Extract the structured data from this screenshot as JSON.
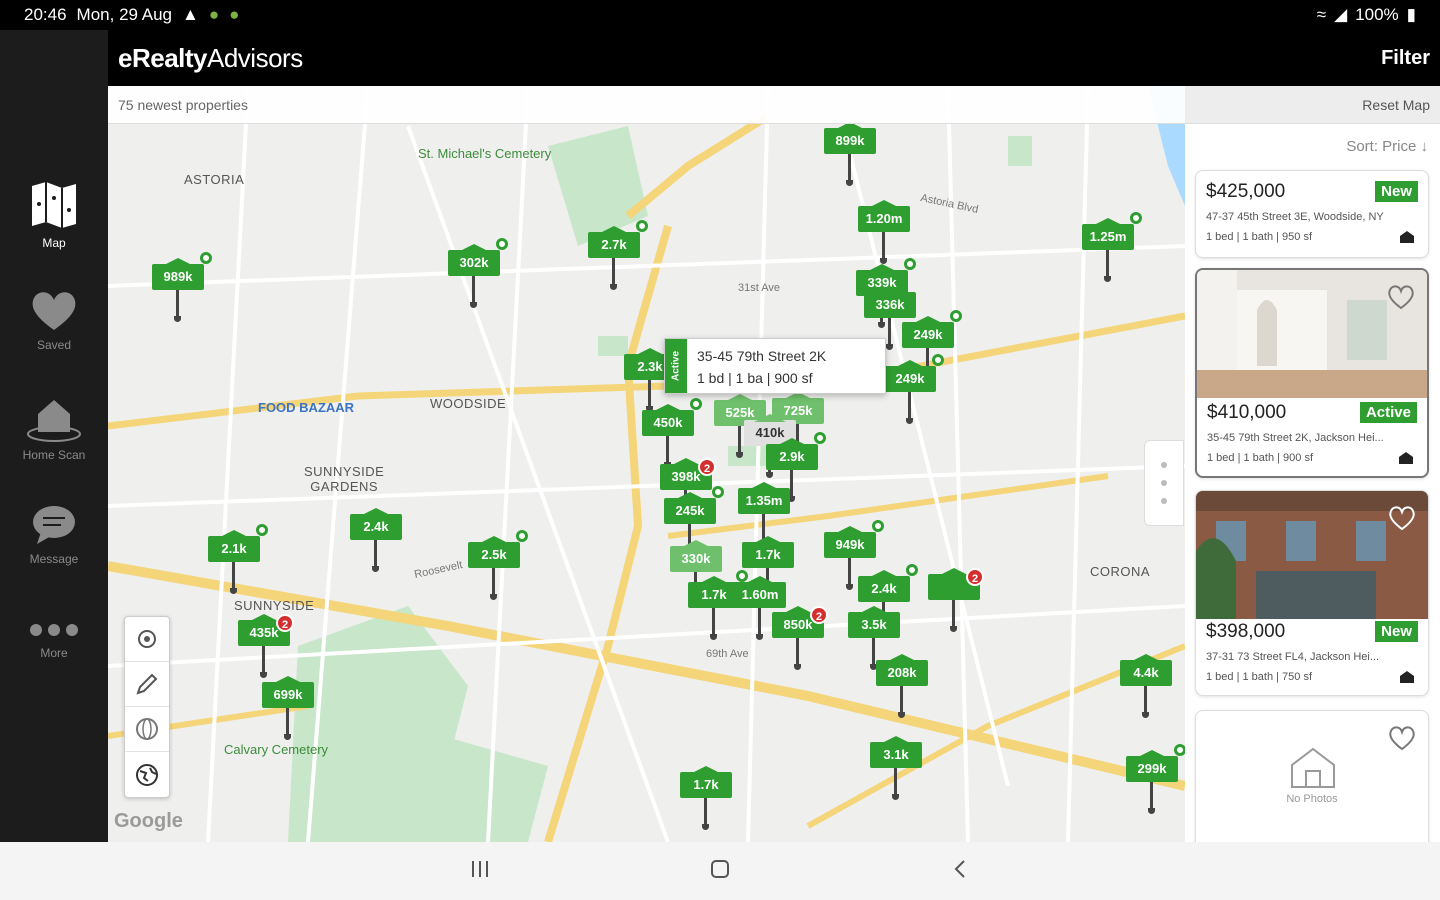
{
  "status_bar": {
    "time": "20:46",
    "date": "Mon, 29 Aug",
    "battery": "100%"
  },
  "header": {
    "logo_bold": "eRealty",
    "logo_light": "Advisors",
    "filter_label": "Filter"
  },
  "subbar": {
    "count_text": "75 newest properties",
    "reset_label": "Reset Map"
  },
  "sidebar": {
    "items": [
      {
        "label": "Map",
        "icon": "map-icon"
      },
      {
        "label": "Saved",
        "icon": "heart-icon"
      },
      {
        "label": "Home Scan",
        "icon": "home-scan-icon"
      },
      {
        "label": "Message",
        "icon": "message-icon"
      },
      {
        "label": "More",
        "icon": "more-icon"
      }
    ]
  },
  "map_labels": {
    "astoria": "ASTORIA",
    "cemetery": "St. Michael's Cemetery",
    "woodside": "WOODSIDE",
    "sunnyside_gardens": "SUNNYSIDE\nGARDENS",
    "sunnyside": "SUNNYSIDE",
    "corona": "CORONA",
    "food_bazaar": "FOOD BAZAAR",
    "calvary": "Calvary Cemetery",
    "ave31": "31st Ave",
    "astoria_blvd": "Astoria Blvd",
    "roosevelt": "Roosevelt",
    "ave69": "69th Ave",
    "google": "Google"
  },
  "pins": [
    {
      "label": "899k"
    },
    {
      "label": "1.20m"
    },
    {
      "label": "1.25m"
    },
    {
      "label": "2.7k"
    },
    {
      "label": "302k"
    },
    {
      "label": "989k"
    },
    {
      "label": "339k"
    },
    {
      "label": "336k"
    },
    {
      "label": "249k"
    },
    {
      "label": "249k"
    },
    {
      "label": "2.3k"
    },
    {
      "label": "450k"
    },
    {
      "label": "525k"
    },
    {
      "label": "725k"
    },
    {
      "label": "410k"
    },
    {
      "label": "2.9k"
    },
    {
      "label": "398k"
    },
    {
      "label": "245k"
    },
    {
      "label": "1.35m"
    },
    {
      "label": "2.4k"
    },
    {
      "label": "2.1k"
    },
    {
      "label": "2.5k"
    },
    {
      "label": "330k"
    },
    {
      "label": "1.7k"
    },
    {
      "label": "949k"
    },
    {
      "label": "1.7k"
    },
    {
      "label": "1.60m"
    },
    {
      "label": "850k"
    },
    {
      "label": "2.4k"
    },
    {
      "label": "3.5k"
    },
    {
      "label": "208k"
    },
    {
      "label": "4.4k"
    },
    {
      "label": "3.1k"
    },
    {
      "label": "1.7k"
    },
    {
      "label": "299k"
    },
    {
      "label": "699k"
    },
    {
      "label": "435k"
    },
    {
      "label": "725k"
    }
  ],
  "popup": {
    "status": "Active",
    "address": "35-45 79th Street 2K",
    "details": "1 bd | 1 ba | 900 sf"
  },
  "panel": {
    "sort_label": "Sort: Price ↓",
    "cards": [
      {
        "price": "$425,000",
        "status": "New",
        "address": "47-37 45th Street 3E, Woodside, NY",
        "meta": "1 bed | 1 bath | 950 sf"
      },
      {
        "price": "$410,000",
        "status": "Active",
        "address": "35-45 79th Street 2K, Jackson Hei...",
        "meta": "1 bed | 1 bath | 900 sf"
      },
      {
        "price": "$398,000",
        "status": "New",
        "address": "37-31 73 Street FL4, Jackson Hei...",
        "meta": "1 bed | 1 bath | 750 sf"
      },
      {
        "no_photos": "No Photos"
      }
    ]
  }
}
